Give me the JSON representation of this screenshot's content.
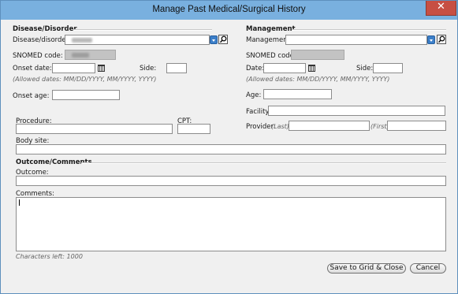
{
  "window": {
    "title": "Manage Past Medical/Surgical History",
    "close_glyph": "✕"
  },
  "disease": {
    "section_title": "Disease/Disorder",
    "field_label": "Disease/disorder:",
    "snomed_label": "SNOMED code:",
    "onset_date_label": "Onset date:",
    "side_label": "Side:",
    "allowed_dates": "(Allowed dates: MM/DD/YYYY, MM/YYYY, YYYY)",
    "onset_age_label": "Onset age:"
  },
  "management": {
    "section_title": "Management",
    "field_label": "Management:",
    "snomed_label": "SNOMED code:",
    "date_label": "Date:",
    "side_label": "Side:",
    "allowed_dates": "(Allowed dates: MM/DD/YYYY, MM/YYYY, YYYY)",
    "age_label": "Age:",
    "facility_label": "Facility:",
    "provider_label": "Provider:",
    "last_label": "(Last)",
    "first_label": "(First)"
  },
  "procedure": {
    "procedure_label": "Procedure:",
    "cpt_label": "CPT:",
    "body_site_label": "Body site:"
  },
  "outcome": {
    "section_title": "Outcome/Comments",
    "outcome_label": "Outcome:",
    "comments_label": "Comments:",
    "chars_left": "Characters left: 1000"
  },
  "buttons": {
    "save": "Save to Grid & Close",
    "cancel": "Cancel"
  },
  "icons": {
    "dropdown": "chevron-down-icon",
    "search": "magnifier-icon",
    "calendar": "calendar-icon"
  }
}
